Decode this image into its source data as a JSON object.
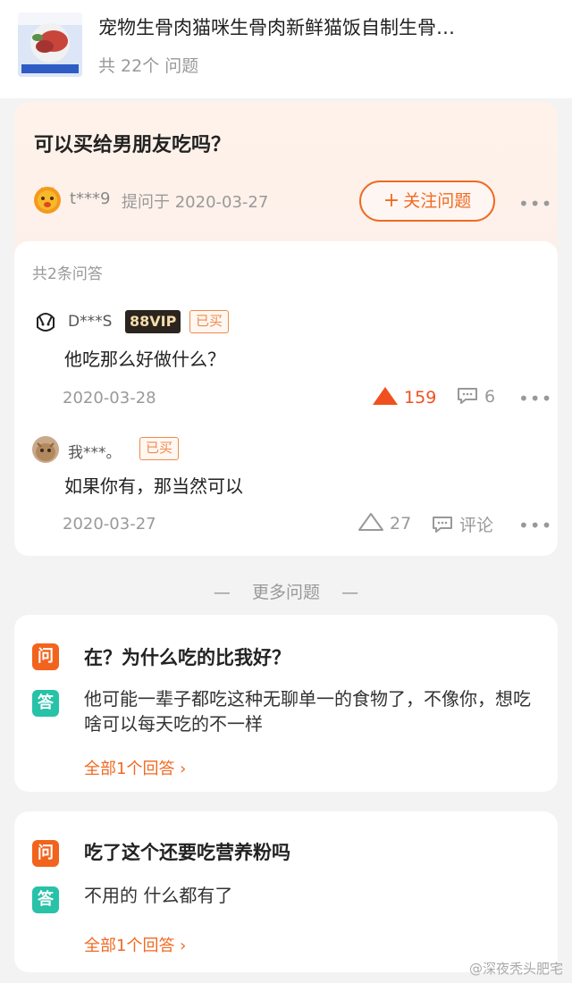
{
  "product": {
    "title": "宠物生骨肉猫咪生骨肉新鲜猫饭自制生骨…",
    "question_count": "共 22个 问题"
  },
  "question": {
    "title": "可以买给男朋友吃吗？",
    "asker": "t***9",
    "asked_on": "提问于 2020-03-27",
    "follow_label": "关注问题"
  },
  "answers": {
    "count_label": "共2条问答",
    "items": [
      {
        "user": "D***S",
        "vip": "88VIP",
        "bought": "已买",
        "text": "他吃那么好做什么？",
        "date": "2020-03-28",
        "likes": "159",
        "comments": "6"
      },
      {
        "user": "我***。",
        "bought": "已买",
        "text": "如果你有，那当然可以",
        "date": "2020-03-27",
        "likes": "27",
        "comments": "评论"
      }
    ]
  },
  "more": {
    "divider": "—    更多问题    —",
    "items": [
      {
        "q_icon": "问",
        "a_icon": "答",
        "question": "在？为什么吃的比我好？",
        "answer": "他可能一辈子都吃这种无聊单一的食物了，不像你，想吃啥可以每天吃的不一样",
        "all": "全部1个回答"
      },
      {
        "q_icon": "问",
        "a_icon": "答",
        "question": "吃了这个还要吃营养粉吗",
        "answer": "不用的  什么都有了",
        "all": "全部1个回答"
      }
    ]
  },
  "watermark": "@深夜秃头肥宅",
  "colors": {
    "accent": "#f06a22",
    "answer_icon": "#27c2a8",
    "background": "#f3f3f3"
  }
}
